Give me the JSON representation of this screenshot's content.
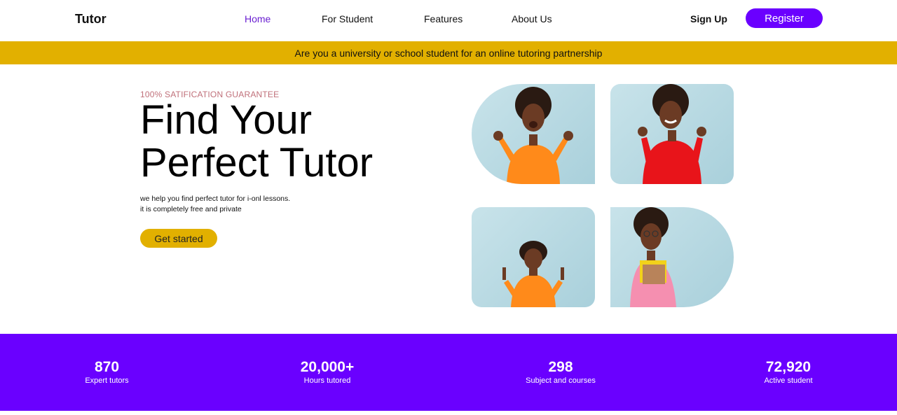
{
  "nav": {
    "logo": "Tutor",
    "links": [
      "Home",
      "For Student",
      "Features",
      "About Us"
    ],
    "active_link": "Home",
    "signup_label": "Sign Up",
    "register_label": "Register"
  },
  "banner": {
    "text": "Are you a university or school student for an online tutoring partnership"
  },
  "hero": {
    "tagline": "100% SATIFICATION GUARANTEE",
    "title_line1": "Find Your",
    "title_line2": "Perfect Tutor",
    "subtitle_line1": "we help you find perfect tutor for i-onl lessons.",
    "subtitle_line2": "it is completely free and private",
    "cta_label": "Get started"
  },
  "photos": [
    {
      "sweater_color": "#ff8a1a"
    },
    {
      "sweater_color": "#e8141a"
    },
    {
      "sweater_color": "#ff8a1a"
    },
    {
      "sweater_color": "#f58fb0"
    }
  ],
  "stats": [
    {
      "value": "870",
      "label": "Expert tutors"
    },
    {
      "value": "20,000+",
      "label": "Hours tutored"
    },
    {
      "value": "298",
      "label": "Subject and courses"
    },
    {
      "value": "72,920",
      "label": "Active student"
    }
  ],
  "colors": {
    "accent_purple": "#6a00ff",
    "banner_yellow": "#e2b000",
    "tagline_pink": "#c0707a"
  }
}
